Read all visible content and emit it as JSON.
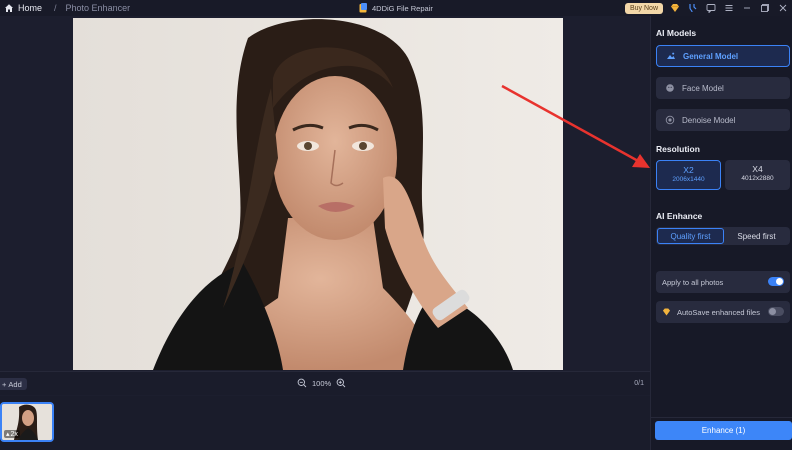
{
  "titlebar": {
    "home_label": "Home",
    "breadcrumb": "Photo Enhancer",
    "app_title": "4DDiG File Repair",
    "buy_now": "Buy Now"
  },
  "canvas": {
    "add_label": "Add",
    "zoom": "100%",
    "page_count": "0/1"
  },
  "thumbnail": {
    "badge": "2x"
  },
  "panel": {
    "ai_models_title": "AI Models",
    "models": [
      {
        "label": "General Model",
        "icon": "landscape-icon",
        "active": true
      },
      {
        "label": "Face Model",
        "icon": "face-icon",
        "active": false
      },
      {
        "label": "Denoise Model",
        "icon": "denoise-icon",
        "active": false
      }
    ],
    "resolution_title": "Resolution",
    "resolutions": [
      {
        "label": "X2",
        "size": "2006x1440",
        "active": true
      },
      {
        "label": "X4",
        "size": "4012x2880",
        "active": false
      }
    ],
    "ai_enhance_title": "AI Enhance",
    "enhance_modes": [
      {
        "label": "Quality first",
        "active": true
      },
      {
        "label": "Speed first",
        "active": false
      }
    ],
    "apply_all_label": "Apply to all photos",
    "apply_all_on": true,
    "autosave_label": "AutoSave enhanced files",
    "autosave_on": false,
    "enhance_button": "Enhance (1)"
  },
  "colors": {
    "accent": "#3b82f6",
    "background": "#1c1e2e",
    "panel": "#171927",
    "annotation_arrow": "#e8332e"
  }
}
